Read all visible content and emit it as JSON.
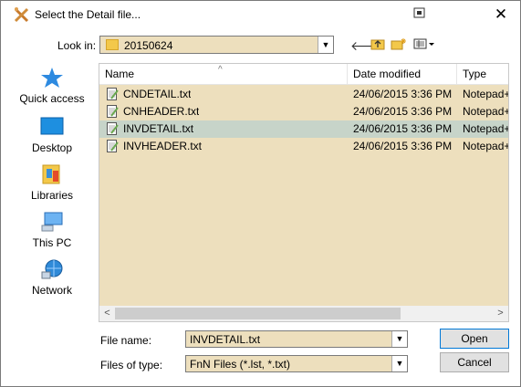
{
  "window": {
    "title": "Select the Detail file...",
    "icon": "tools-icon",
    "help_icon": "context-help-icon",
    "close_label": "✕"
  },
  "lookin": {
    "label": "Look in:",
    "value": "20150624"
  },
  "toolbar": {
    "back": "🡐",
    "up": "⬑",
    "new_folder": "✱",
    "view": "▤▾"
  },
  "places": [
    {
      "label": "Quick access",
      "icon": "star-icon"
    },
    {
      "label": "Desktop",
      "icon": "desktop-icon"
    },
    {
      "label": "Libraries",
      "icon": "libraries-icon"
    },
    {
      "label": "This PC",
      "icon": "computer-icon"
    },
    {
      "label": "Network",
      "icon": "network-icon"
    }
  ],
  "list": {
    "columns": [
      "Name",
      "Date modified",
      "Type"
    ],
    "rows": [
      {
        "name": "CNDETAIL.txt",
        "date": "24/06/2015 3:36 PM",
        "type": "Notepad+"
      },
      {
        "name": "CNHEADER.txt",
        "date": "24/06/2015 3:36 PM",
        "type": "Notepad+"
      },
      {
        "name": "INVDETAIL.txt",
        "date": "24/06/2015 3:36 PM",
        "type": "Notepad+"
      },
      {
        "name": "INVHEADER.txt",
        "date": "24/06/2015 3:36 PM",
        "type": "Notepad+"
      }
    ],
    "selected_index": 2
  },
  "filename": {
    "label": "File name:",
    "value": "INVDETAIL.txt"
  },
  "filetype": {
    "label": "Files of type:",
    "value": "FnN Files (*.lst, *.txt)"
  },
  "buttons": {
    "open": "Open",
    "cancel": "Cancel"
  },
  "colors": {
    "field_bg": "#eddfbd",
    "selected_row": "#c7d4c9",
    "accent": "#0078d7"
  }
}
